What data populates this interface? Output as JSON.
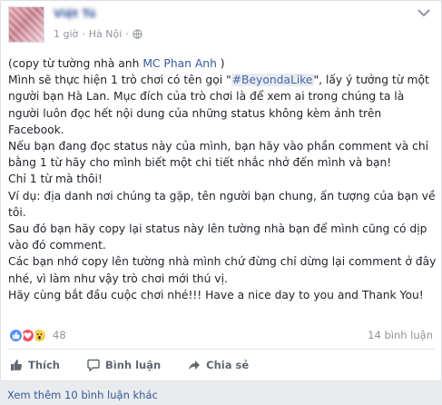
{
  "post": {
    "author": "Việt Tú",
    "time": "1 giờ",
    "separator": "·",
    "location": "Hà Nội",
    "privacy_icon": "globe-icon",
    "menu_icon": "chevron-down-icon",
    "lines": [
      {
        "parts": [
          {
            "t": "(copy từ tường nhà anh "
          },
          {
            "t": "MC Phan Anh",
            "c": "link"
          },
          {
            "t": " )"
          }
        ]
      },
      {
        "parts": [
          {
            "t": "Mình sẽ thực hiện 1 trò chơi có tên gọi \""
          },
          {
            "t": "#BeyondaLike",
            "c": "tag"
          },
          {
            "t": "\", lấy ý tưởng từ một người bạn Hà Lan. Mục đích của trò chơi là để xem ai trong chúng ta là người luôn đọc hết nội dung của những status không kèm ảnh trên Facebook."
          }
        ]
      },
      {
        "parts": [
          {
            "t": "Nếu bạn đang đọc status này của mình, bạn hãy vào phần comment và chỉ bằng 1 từ hãy cho mình biết một chi tiết nhắc nhở đến mình và bạn!"
          }
        ]
      },
      {
        "parts": [
          {
            "t": "Chỉ 1 từ mà thôi!"
          }
        ]
      },
      {
        "parts": [
          {
            "t": "Ví dụ: địa danh nơi chúng ta gặp, tên người bạn chung, ấn tượng của bạn về tôi."
          }
        ]
      },
      {
        "parts": [
          {
            "t": "Sau đó bạn hãy copy lại status này lên tường nhà bạn để mình cũng có dịp vào đó comment."
          }
        ]
      },
      {
        "parts": [
          {
            "t": "Các bạn nhớ copy lên tường nhà mình chứ đừng chỉ dừng lại comment ở đây nhé, vì làm như vậy trò chơi mới thú vị."
          }
        ]
      },
      {
        "parts": [
          {
            "t": "Hãy cùng bắt đầu cuộc chơi nhé!!! Have a nice day to you and Thank You!"
          }
        ]
      }
    ]
  },
  "reactions": {
    "icons": [
      "like-reaction-icon",
      "love-reaction-icon",
      "wow-reaction-icon"
    ],
    "count": "48",
    "comments": "14 bình luận"
  },
  "actions": {
    "like": "Thích",
    "comment": "Bình luận",
    "share": "Chia sẻ"
  },
  "more_comments": "Xem thêm 10 bình luận khác",
  "colors": {
    "link": "#365899",
    "like": "#5890ff",
    "love": "#f25268",
    "wow": "#fbd050"
  }
}
